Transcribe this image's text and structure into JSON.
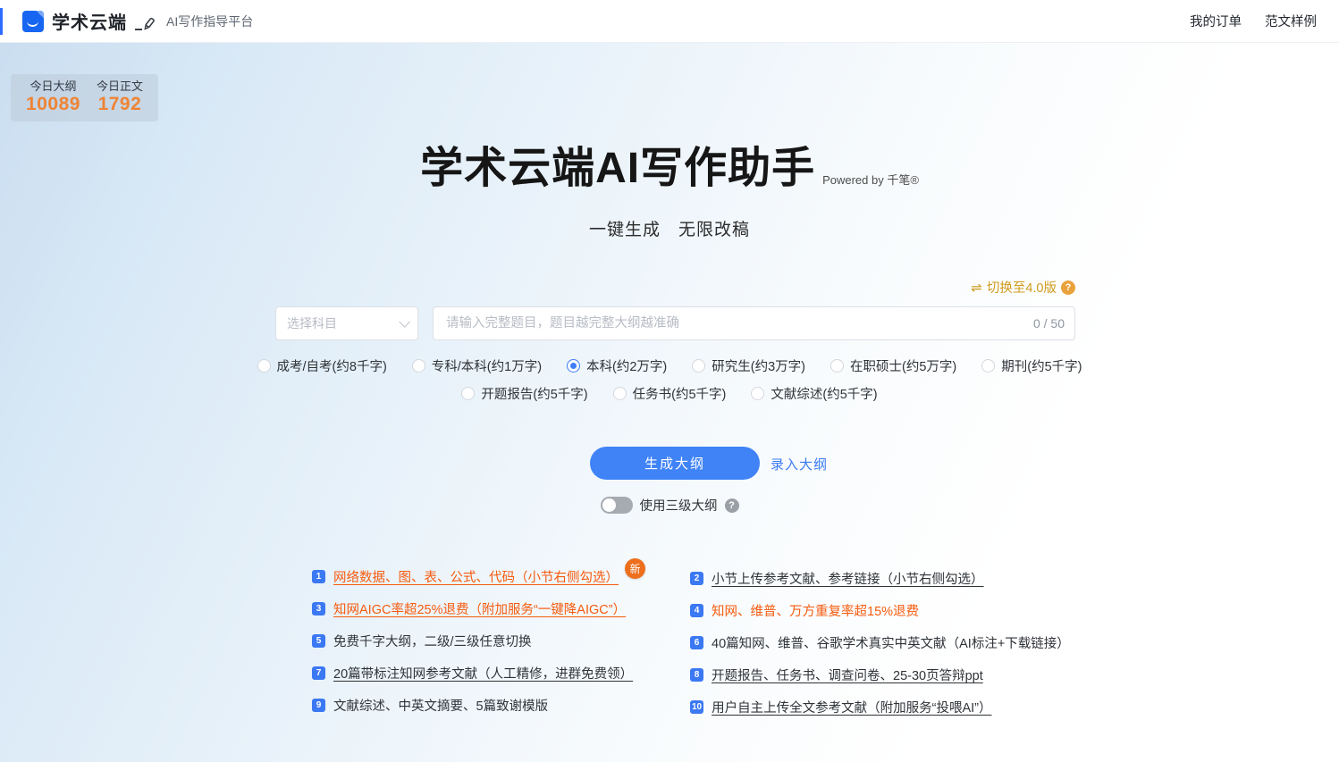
{
  "header": {
    "brand": "学术云端",
    "tagline": "AI写作指导平台",
    "nav": [
      {
        "name": "my-orders",
        "label": "我的订单"
      },
      {
        "name": "sample-essays",
        "label": "范文样例"
      }
    ]
  },
  "stats": {
    "items": [
      {
        "name": "today-outline",
        "label": "今日大纲",
        "value": "10089"
      },
      {
        "name": "today-body",
        "label": "今日正文",
        "value": "1792"
      }
    ]
  },
  "hero": {
    "title": "学术云端AI写作助手",
    "powered_by": "Powered by 千笔®",
    "subtitle": "一键生成　无限改稿"
  },
  "version_switch": {
    "icon": "⇌",
    "label": "切换至4.0版",
    "help": "?"
  },
  "form": {
    "subject_select": {
      "placeholder": "选择科目"
    },
    "title_input": {
      "placeholder": "请输入完整题目，题目越完整大纲越准确",
      "counter": "0 / 50"
    },
    "radios_row1": [
      {
        "label": "成考/自考(约8千字)",
        "checked": false
      },
      {
        "label": "专科/本科(约1万字)",
        "checked": false
      },
      {
        "label": "本科(约2万字)",
        "checked": true
      },
      {
        "label": "研究生(约3万字)",
        "checked": false
      },
      {
        "label": "在职硕士(约5万字)",
        "checked": false
      },
      {
        "label": "期刊(约5千字)",
        "checked": false
      }
    ],
    "radios_row2": [
      {
        "label": "开题报告(约5千字)",
        "checked": false
      },
      {
        "label": "任务书(约5千字)",
        "checked": false
      },
      {
        "label": "文献综述(约5千字)",
        "checked": false
      }
    ],
    "generate_button": "生成大纲",
    "manual_link": "录入大纲",
    "toggle_label": "使用三级大纲",
    "toggle_help": "?"
  },
  "features": {
    "left": [
      {
        "num": "1",
        "text": "网络数据、图、表、公式、代码（小节右侧勾选）",
        "style": "orange u",
        "badge": "新"
      },
      {
        "num": "3",
        "text": "知网AIGC率超25%退费（附加服务“一键降AIGC”）",
        "style": "orange u"
      },
      {
        "num": "5",
        "text": "免费千字大纲，二级/三级任意切换",
        "style": "dark"
      },
      {
        "num": "7",
        "text": "20篇带标注知网参考文献（人工精修，进群免费领）",
        "style": "dark u"
      },
      {
        "num": "9",
        "text": "文献综述、中英文摘要、5篇致谢模版",
        "style": "dark"
      }
    ],
    "right": [
      {
        "num": "2",
        "text": "小节上传参考文献、参考链接（小节右侧勾选）",
        "style": "dark u"
      },
      {
        "num": "4",
        "text": "知网、维普、万方重复率超15%退费",
        "style": "orange"
      },
      {
        "num": "6",
        "text": "40篇知网、维普、谷歌学术真实中英文献（AI标注+下载链接）",
        "style": "dark"
      },
      {
        "num": "8",
        "text": "开题报告、任务书、调查问卷、25-30页答辩ppt",
        "style": "dark u"
      },
      {
        "num": "10",
        "text": "用户自主上传全文参考文献（附加服务“投喂AI”）",
        "style": "dark u"
      }
    ]
  },
  "colors": {
    "accent_blue": "#3f83f6",
    "stat_orange": "#ee8435",
    "feature_orange": "#f55b0e",
    "gold": "#cf9a1c"
  }
}
